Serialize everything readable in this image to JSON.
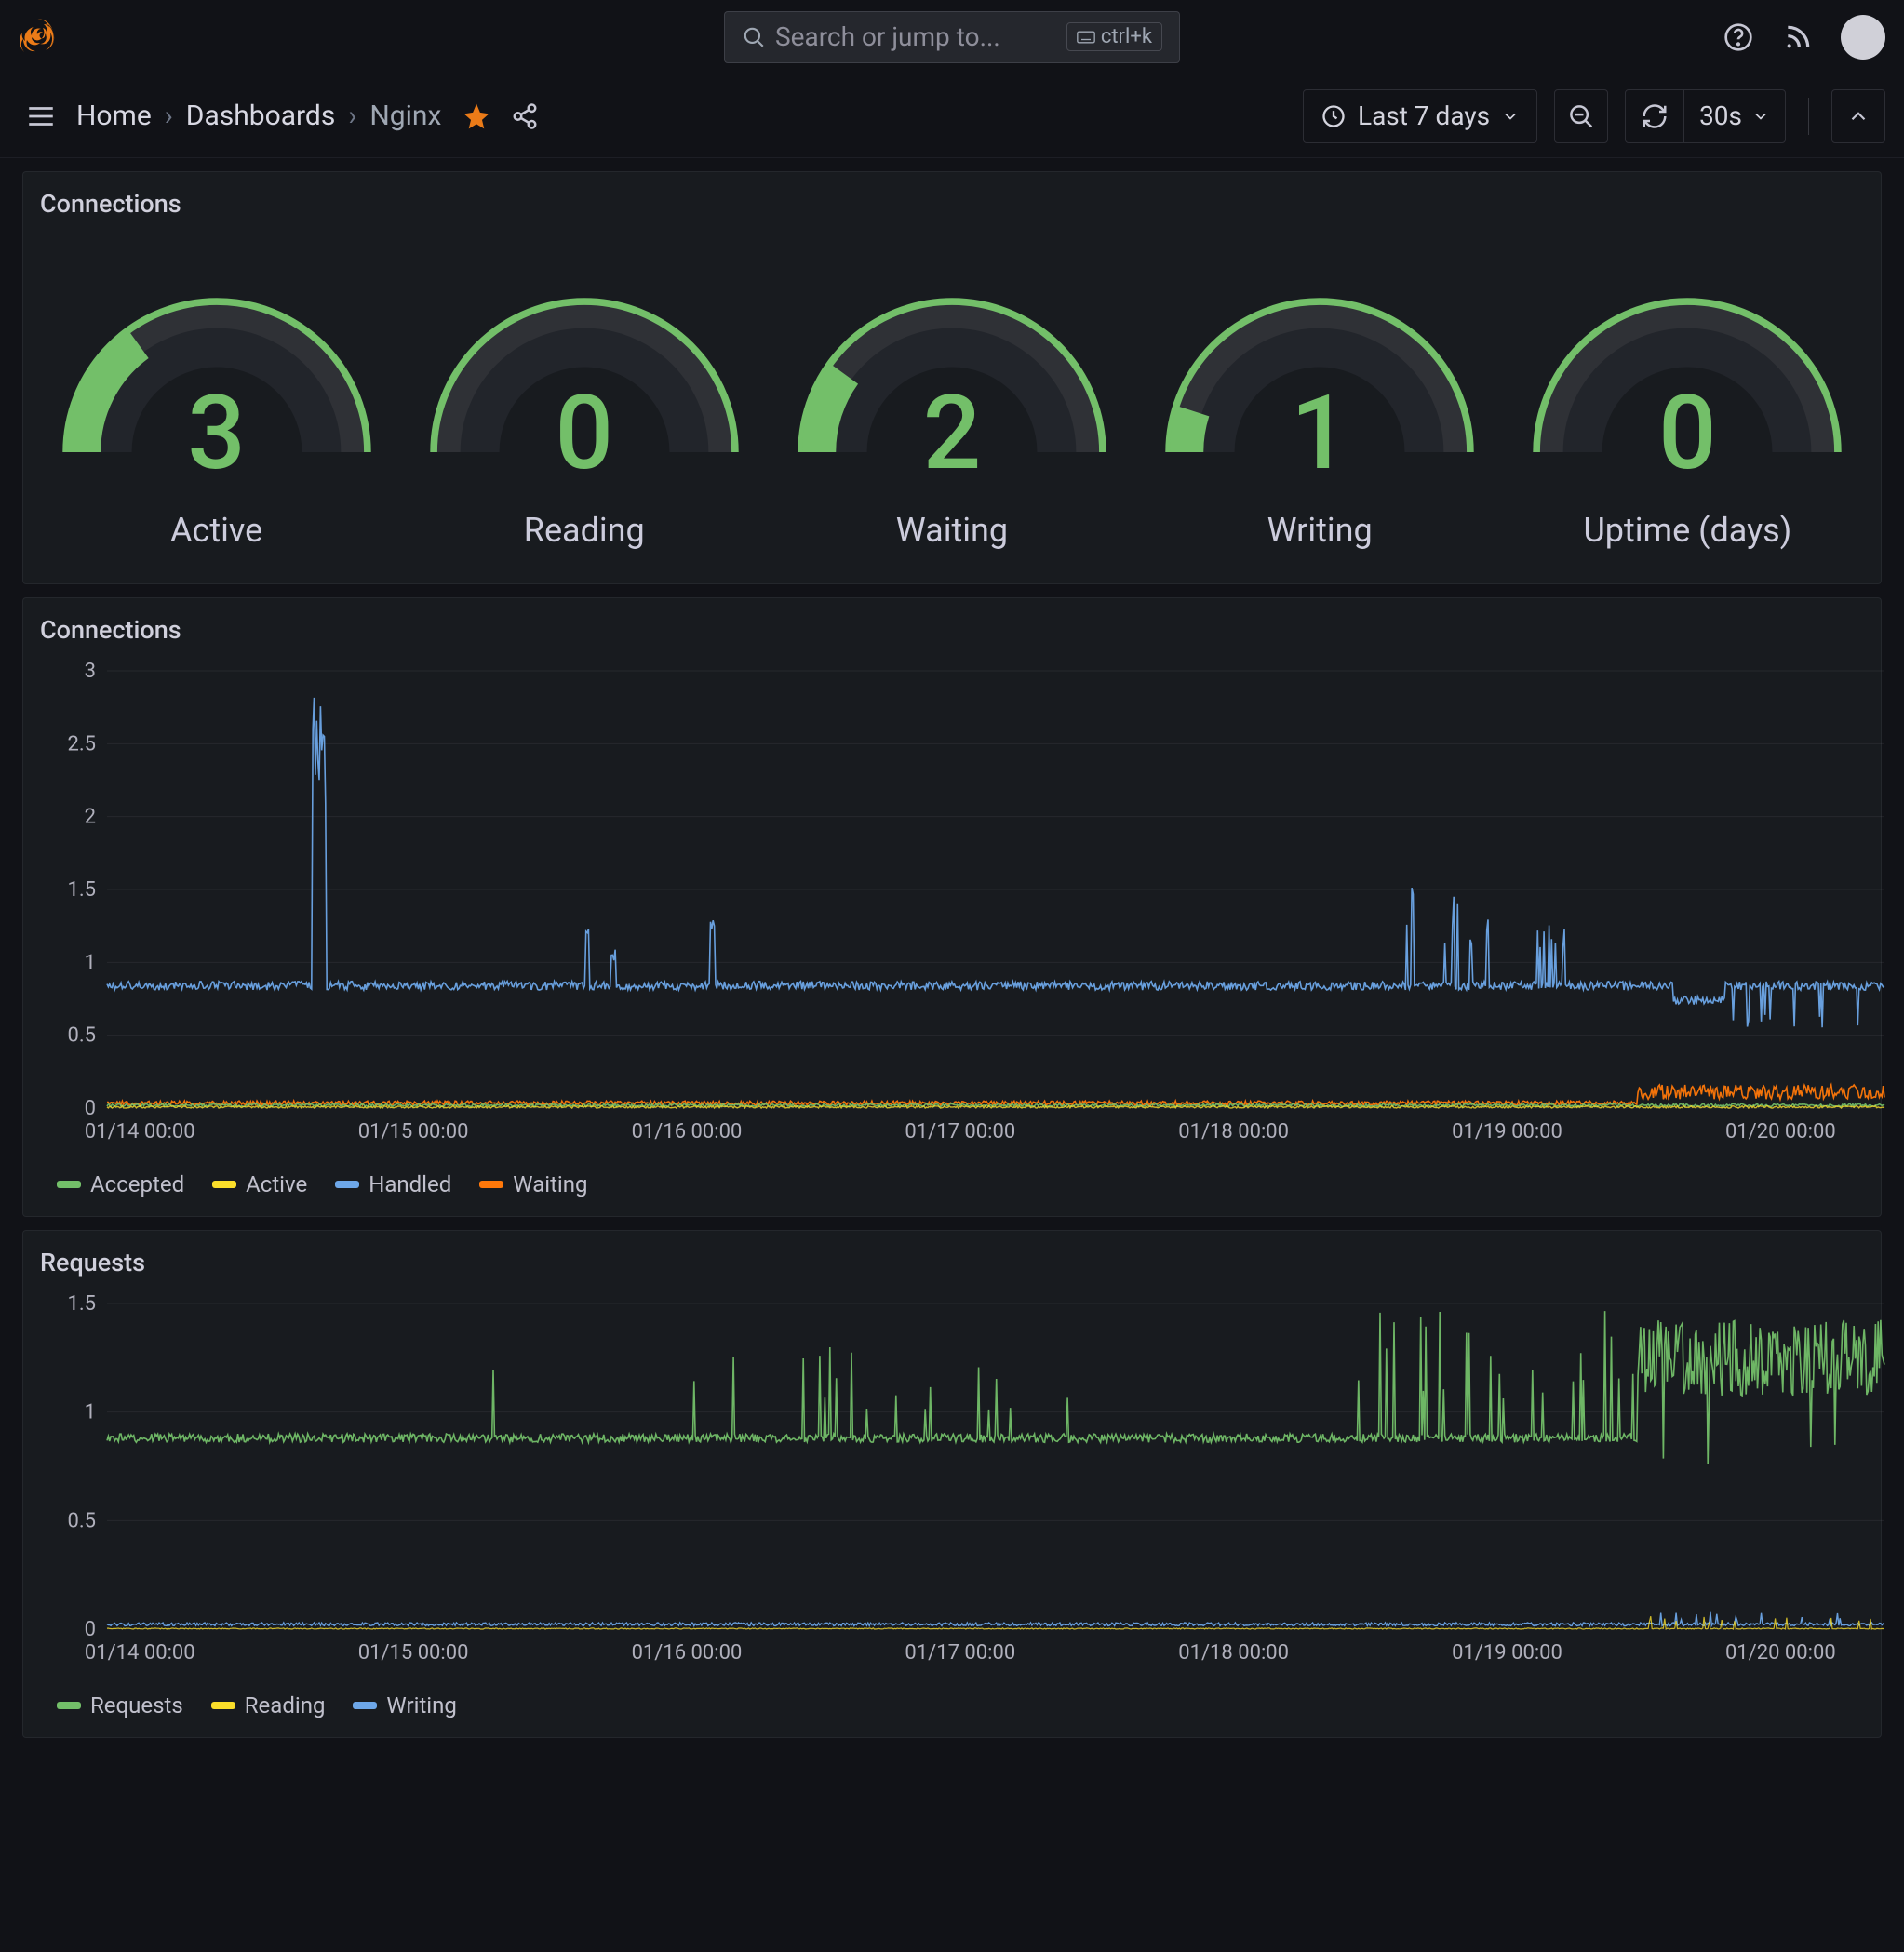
{
  "header": {
    "search_placeholder": "Search or jump to...",
    "search_shortcut": "ctrl+k"
  },
  "toolbar": {
    "breadcrumbs": [
      "Home",
      "Dashboards",
      "Nginx"
    ],
    "time_range": "Last 7 days",
    "refresh_interval": "30s"
  },
  "colors": {
    "green": "#73BF69",
    "yellow": "#FADE2A",
    "blue": "#6da7e8",
    "orange": "#FF780A",
    "gauge_track": "#2f3136",
    "gauge_track_inner": "#22252b"
  },
  "panels": {
    "gauges": {
      "title": "Connections",
      "items": [
        {
          "label": "Active",
          "value": "3",
          "fraction": 0.3
        },
        {
          "label": "Reading",
          "value": "0",
          "fraction": 0.0
        },
        {
          "label": "Waiting",
          "value": "2",
          "fraction": 0.2
        },
        {
          "label": "Writing",
          "value": "1",
          "fraction": 0.1
        },
        {
          "label": "Uptime (days)",
          "value": "0",
          "fraction": 0.0
        }
      ]
    },
    "connections_chart": {
      "title": "Connections",
      "legend": [
        {
          "label": "Accepted",
          "color": "#73BF69"
        },
        {
          "label": "Active",
          "color": "#FADE2A"
        },
        {
          "label": "Handled",
          "color": "#6da7e8"
        },
        {
          "label": "Waiting",
          "color": "#FF780A"
        }
      ],
      "x_ticks": [
        "01/14 00:00",
        "01/15 00:00",
        "01/16 00:00",
        "01/17 00:00",
        "01/18 00:00",
        "01/19 00:00",
        "01/20 00:00"
      ],
      "y_ticks": [
        "0",
        "0.5",
        "1",
        "1.5",
        "2",
        "2.5",
        "3"
      ]
    },
    "requests_chart": {
      "title": "Requests",
      "legend": [
        {
          "label": "Requests",
          "color": "#73BF69"
        },
        {
          "label": "Reading",
          "color": "#FADE2A"
        },
        {
          "label": "Writing",
          "color": "#6da7e8"
        }
      ],
      "x_ticks": [
        "01/14 00:00",
        "01/15 00:00",
        "01/16 00:00",
        "01/17 00:00",
        "01/18 00:00",
        "01/19 00:00",
        "01/20 00:00"
      ],
      "y_ticks": [
        "0",
        "0.5",
        "1",
        "1.5"
      ]
    }
  },
  "chart_data": [
    {
      "title": "Connections (gauges)",
      "type": "gauge",
      "series": [
        {
          "name": "Active",
          "value": 3
        },
        {
          "name": "Reading",
          "value": 0
        },
        {
          "name": "Waiting",
          "value": 2
        },
        {
          "name": "Writing",
          "value": 1
        },
        {
          "name": "Uptime (days)",
          "value": 0
        }
      ],
      "ylim": [
        0,
        10
      ]
    },
    {
      "title": "Connections",
      "type": "line",
      "xlabel": "",
      "ylabel": "",
      "x": [
        "01/14 00:00",
        "01/15 00:00",
        "01/16 00:00",
        "01/17 00:00",
        "01/18 00:00",
        "01/19 00:00",
        "01/20 00:00"
      ],
      "ylim": [
        0,
        3
      ],
      "series": [
        {
          "name": "Accepted",
          "values": [
            0.0,
            0.0,
            0.0,
            0.0,
            0.0,
            0.0,
            0.05
          ]
        },
        {
          "name": "Active",
          "values": [
            0.0,
            0.0,
            0.0,
            0.0,
            0.0,
            0.0,
            0.0
          ]
        },
        {
          "name": "Handled (baseline)",
          "values": [
            0.85,
            0.85,
            0.85,
            0.85,
            0.85,
            0.85,
            0.85
          ]
        },
        {
          "name": "Waiting",
          "values": [
            0.02,
            0.02,
            0.02,
            0.02,
            0.02,
            0.02,
            0.1
          ]
        }
      ],
      "notes": "Handled shows a ~0.85 baseline with a spike near 2.9 shortly after 01/14, small spikes ~1.2 on 01/15 and 01/16, and a cluster of spikes up to ~1.5 between 01/18 and 01/19. Waiting trends slightly higher (~0.1) after 01/19."
    },
    {
      "title": "Requests",
      "type": "line",
      "xlabel": "",
      "ylabel": "",
      "x": [
        "01/14 00:00",
        "01/15 00:00",
        "01/16 00:00",
        "01/17 00:00",
        "01/18 00:00",
        "01/19 00:00",
        "01/20 00:00"
      ],
      "ylim": [
        0,
        1.5
      ],
      "series": [
        {
          "name": "Requests (baseline)",
          "values": [
            0.88,
            0.88,
            0.88,
            0.9,
            0.9,
            0.95,
            1.25
          ]
        },
        {
          "name": "Reading",
          "values": [
            0.0,
            0.0,
            0.0,
            0.0,
            0.0,
            0.0,
            0.0
          ]
        },
        {
          "name": "Writing",
          "values": [
            0.02,
            0.02,
            0.02,
            0.02,
            0.02,
            0.02,
            0.02
          ]
        }
      ],
      "notes": "Requests baseline ~0.88 with intermittent spikes to ~1.0–1.3 between 01/15 and 01/18; sustained elevation to ~1.3–1.45 after 01/19 with a brief dip to ~0.7."
    }
  ]
}
